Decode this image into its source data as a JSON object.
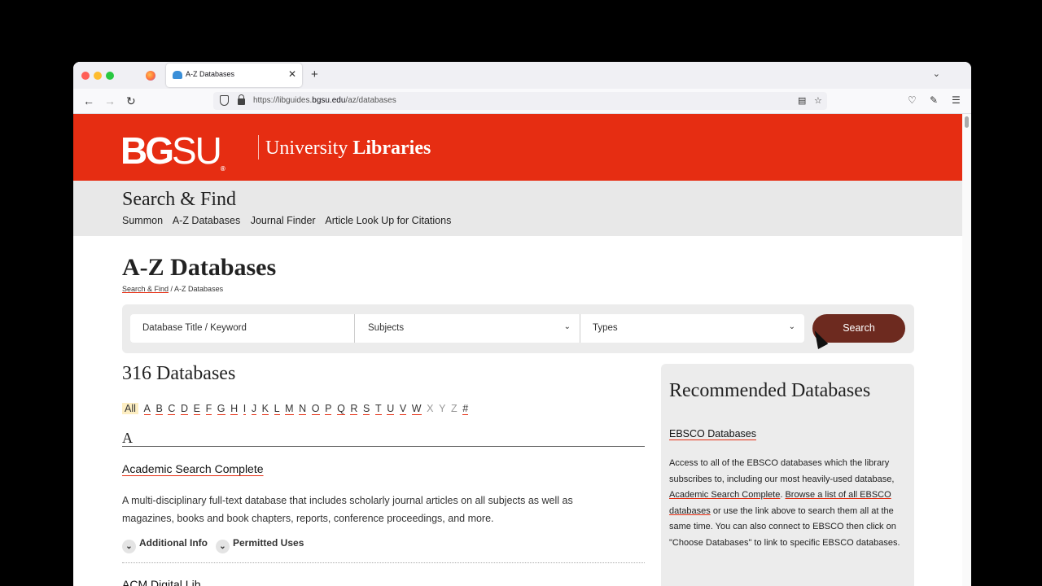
{
  "browser": {
    "tab_title": "A-Z Databases",
    "tab_close": "✕",
    "new_tab": "+",
    "url_prefix": "https://libguides.",
    "url_domain": "bgsu.edu",
    "url_path": "/az/databases"
  },
  "header": {
    "logo_bg": "BG",
    "logo_su": "SU",
    "logo_reg": "®",
    "unit_light": "University ",
    "unit_bold": "Libraries"
  },
  "subnav": {
    "title": "Search & Find",
    "links": [
      "Summon",
      "A-Z Databases",
      "Journal Finder",
      "Article Look Up for Citations"
    ]
  },
  "page": {
    "title": "A-Z Databases",
    "breadcrumb_link": "Search & Find",
    "breadcrumb_sep": " / ",
    "breadcrumb_current": "A-Z Databases"
  },
  "search": {
    "keyword_placeholder": "Database Title / Keyword",
    "subjects_label": "Subjects",
    "types_label": "Types",
    "button_label": "Search"
  },
  "results": {
    "count_label": "316 Databases",
    "alphabet": [
      "All",
      "A",
      "B",
      "C",
      "D",
      "E",
      "F",
      "G",
      "H",
      "I",
      "J",
      "K",
      "L",
      "M",
      "N",
      "O",
      "P",
      "Q",
      "R",
      "S",
      "T",
      "U",
      "V",
      "W",
      "X",
      "Y",
      "Z",
      "#"
    ],
    "section_letter": "A",
    "first_db": {
      "title": "Academic Search Complete",
      "description": "A multi-disciplinary full-text database that includes scholarly journal articles on all subjects as well as magazines, books and book chapters, reports, conference proceedings, and more.",
      "additional_info": "Additional Info",
      "permitted_uses": "Permitted Uses"
    },
    "next_db_partial": "ACM Digital Lib"
  },
  "recommended": {
    "heading": "Recommended Databases",
    "link": "EBSCO Databases",
    "text_1": "Access to all of the EBSCO databases which the library subscribes to, including our most heavily-used database, ",
    "link_asc": "Academic Search Complete",
    "text_2": ". ",
    "link_list": "Browse a list of all EBSCO databases",
    "text_3": " or use the link above to search them all at the same time. You can also connect to EBSCO then click on \"Choose Databases\" to link to specific EBSCO databases."
  },
  "colors": {
    "brand_orange": "#e62d12",
    "search_button": "#6d2a1f",
    "band_gray": "#e8e8e8"
  }
}
